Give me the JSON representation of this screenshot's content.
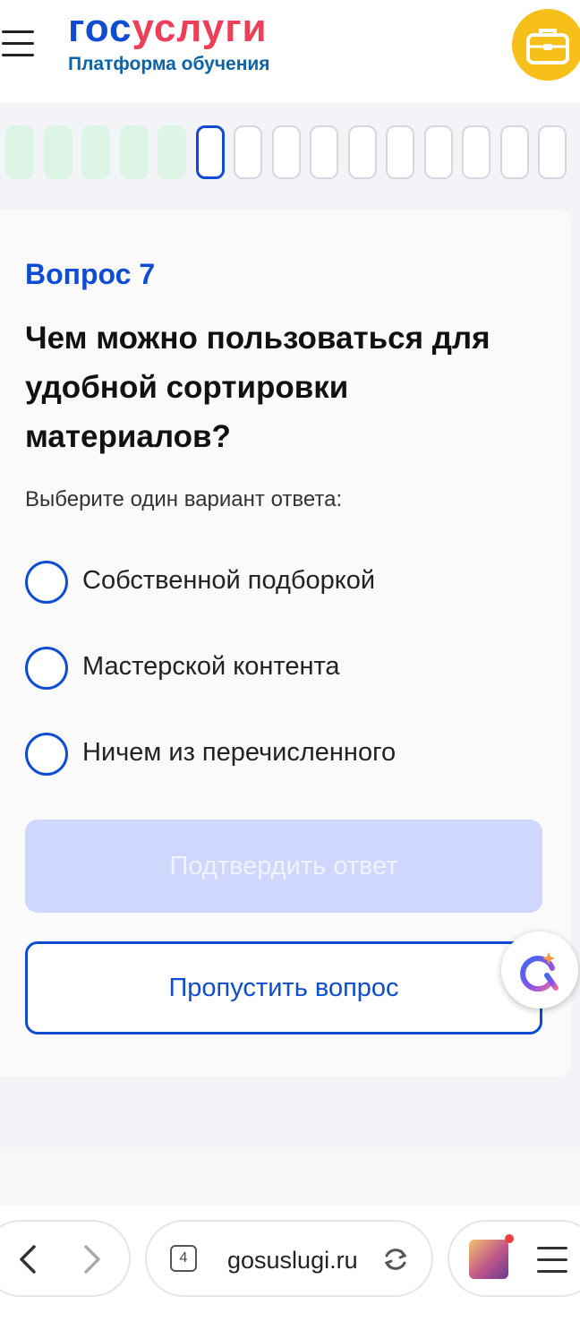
{
  "header": {
    "logo_part1": "гос",
    "logo_part2": "услуги",
    "subtitle": "Платформа обучения",
    "menu_icon": "hamburger-menu-icon",
    "case_icon": "briefcase-icon"
  },
  "progress": {
    "total": 15,
    "completed": 5,
    "current": 6
  },
  "question": {
    "number_label": "Вопрос 7",
    "text": "Чем можно пользоваться для удобной сортировки материалов?",
    "hint": "Выберите один вариант ответа:",
    "options": [
      {
        "label": "Собственной подборкой"
      },
      {
        "label": "Мастерской контента"
      },
      {
        "label": "Ничем из перечисленного"
      }
    ],
    "confirm_label": "Подтвердить ответ",
    "skip_label": "Пропустить вопрос"
  },
  "browser": {
    "tabs_count": "4",
    "url": "gosuslugi.ru"
  },
  "colors": {
    "brand_blue": "#0d4cd3",
    "brand_red": "#ee3f58",
    "done_step": "#dcf5e6",
    "confirm_disabled": "#cfd8fc",
    "case_yellow": "#f7bf1a"
  }
}
